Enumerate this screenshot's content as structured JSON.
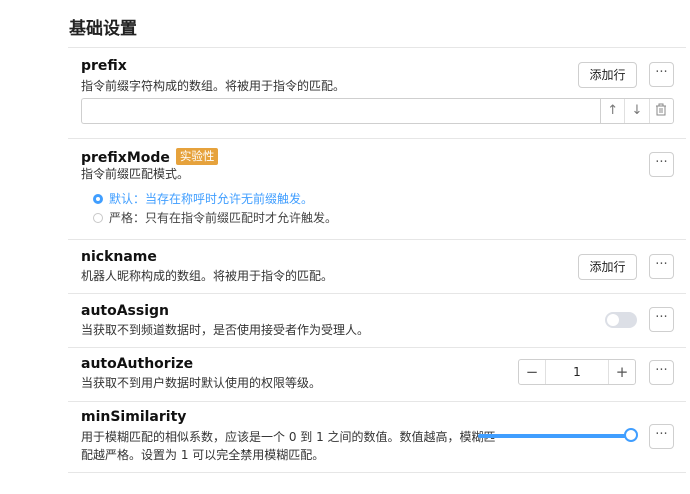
{
  "section_title": "基础设置",
  "more_label": "···",
  "accent_color": "#409eff",
  "badge_color": "#e6a23c",
  "prefix": {
    "name": "prefix",
    "description": "指令前缀字符构成的数组。将被用于指令的匹配。",
    "add_label": "添加行",
    "input_value": "",
    "icons": [
      "arrow-up-icon",
      "arrow-down-icon",
      "trash-icon"
    ]
  },
  "prefixMode": {
    "name": "prefixMode",
    "badge": "实验性",
    "description": "指令前缀匹配模式。",
    "options": [
      {
        "label": "默认：当存在称呼时允许无前缀触发。",
        "checked": true
      },
      {
        "label": "严格：只有在指令前缀匹配时才允许触发。",
        "checked": false
      }
    ]
  },
  "nickname": {
    "name": "nickname",
    "description": "机器人昵称构成的数组。将被用于指令的匹配。",
    "add_label": "添加行"
  },
  "autoAssign": {
    "name": "autoAssign",
    "description": "当获取不到频道数据时，是否使用接受者作为受理人。",
    "enabled": false
  },
  "autoAuthorize": {
    "name": "autoAuthorize",
    "description": "当获取不到用户数据时默认使用的权限等级。",
    "value": "1",
    "minus": "−",
    "plus": "+"
  },
  "minSimilarity": {
    "name": "minSimilarity",
    "description_line1": "用于模糊匹配的相似系数，应该是一个 0 到 1 之间的数值。数值越高，模糊匹",
    "description_line2": "配越严格。设置为 1 可以完全禁用模糊匹配。",
    "slider_fraction": 1.0
  }
}
